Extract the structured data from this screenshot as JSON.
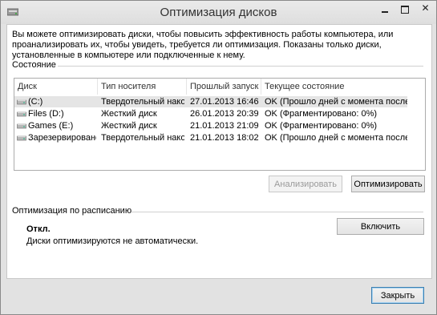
{
  "window": {
    "title": "Оптимизация дисков"
  },
  "description": "Вы можете оптимизировать диски, чтобы повысить эффективность работы  компьютера, или проанализировать их, чтобы увидеть, требуется ли оптимизация. Показаны только диски, установленные в компьютере или подключенные к нему.",
  "status_section": {
    "label": "Состояние"
  },
  "table": {
    "columns": [
      "Диск",
      "Тип носителя",
      "Прошлый запуск",
      "Текущее состояние"
    ],
    "rows": [
      {
        "disk": "(C:)",
        "media": "Твердотельный накоп...",
        "last_run": "27.01.2013 16:46",
        "state": "OK (Прошло дней с момента последне..."
      },
      {
        "disk": "Files (D:)",
        "media": "Жесткий диск",
        "last_run": "26.01.2013 20:39",
        "state": "OK (Фрагментировано: 0%)"
      },
      {
        "disk": "Games (E:)",
        "media": "Жесткий диск",
        "last_run": "21.01.2013 21:09",
        "state": "OK (Фрагментировано: 0%)"
      },
      {
        "disk": "Зарезервировано ...",
        "media": "Твердотельный накоп...",
        "last_run": "21.01.2013 18:02",
        "state": "OK (Прошло дней с момента последне..."
      }
    ]
  },
  "buttons": {
    "analyze": "Анализировать",
    "optimize": "Оптимизировать",
    "enable": "Включить",
    "close": "Закрыть"
  },
  "schedule": {
    "label": "Оптимизация по расписанию",
    "status": "Откл.",
    "description": "Диски оптимизируются не автоматически."
  },
  "colors": {
    "selected_row": "#e5e5e5",
    "accent_border": "#3c7fb1"
  }
}
